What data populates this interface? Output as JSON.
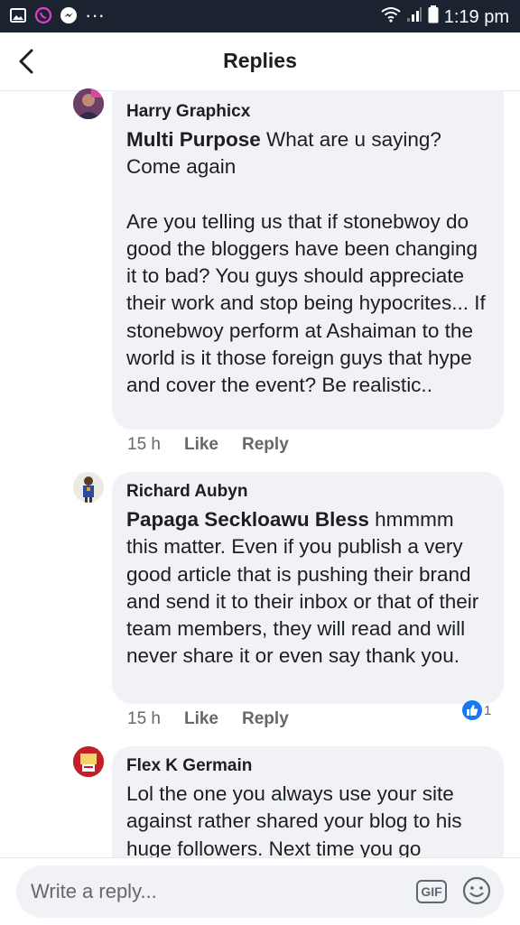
{
  "status_bar": {
    "time": "1:19 pm",
    "dots": "···"
  },
  "header": {
    "title": "Replies"
  },
  "comments": [
    {
      "author": "Harry Graphicx",
      "tag": "Multi Purpose",
      "text": " What are u saying? Come again",
      "text2": "Are you telling us that if stonebwoy do good the bloggers have been changing it to bad? You guys should appreciate their work and stop being hypocrites... If stonebwoy perform at Ashaiman to the world is it those foreign guys that hype and cover the event? Be realistic..",
      "time": "15 h",
      "like": "Like",
      "reply": "Reply"
    },
    {
      "author": "Richard Aubyn",
      "tag": "Papaga Seckloawu Bless",
      "text": " hmmmm this matter. Even if you publish a very good article that is pushing their brand and send it to their inbox or that of their team members, they will read and will never share it or even say thank you.",
      "time": "15 h",
      "like": "Like",
      "reply": "Reply",
      "reaction_count": "1"
    },
    {
      "author": "Flex K Germain",
      "text": "Lol the one you always use your site against rather shared your blog to his huge followers. Next time you go"
    }
  ],
  "composer": {
    "placeholder": "Write a reply...",
    "gif_label": "GIF"
  }
}
